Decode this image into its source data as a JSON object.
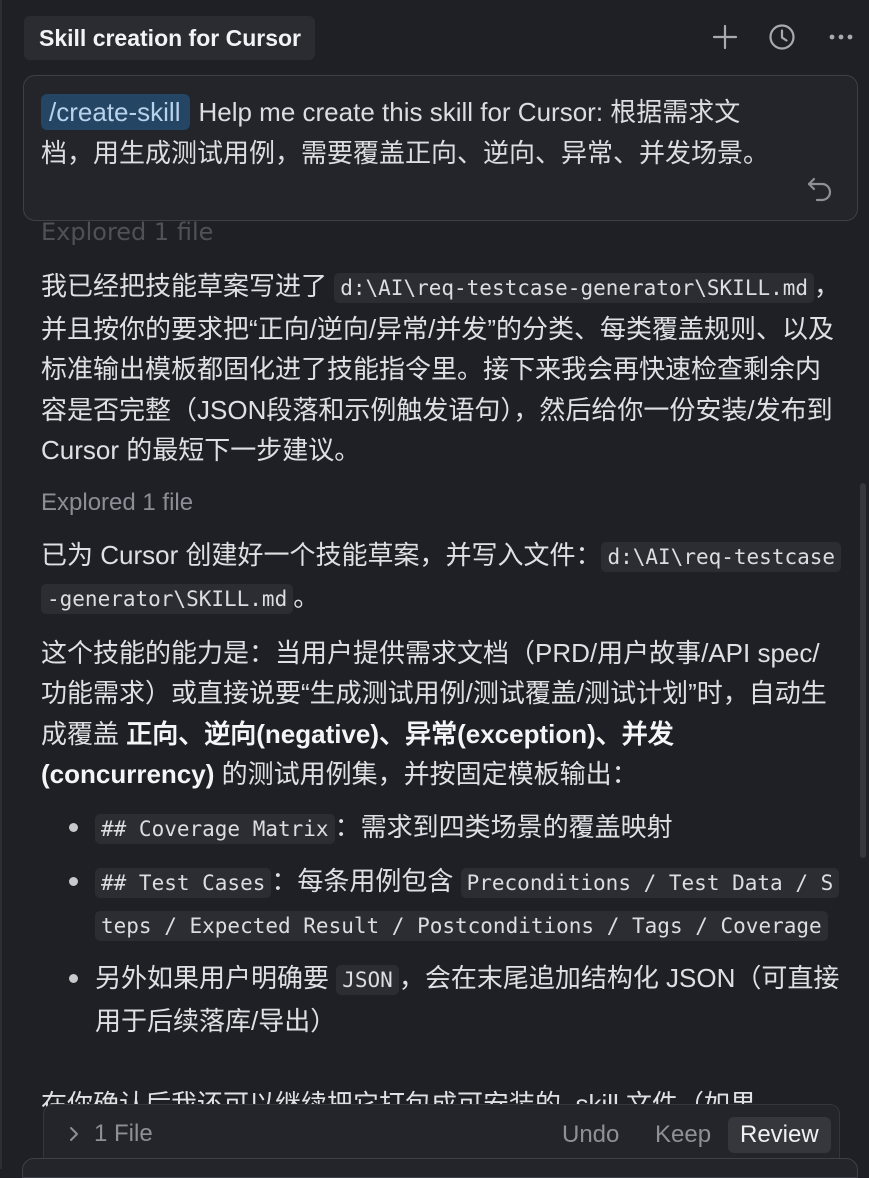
{
  "header": {
    "title": "Skill creation for Cursor",
    "icons": [
      "plus-icon",
      "history-icon",
      "more-icon"
    ]
  },
  "prompt": {
    "command": "/create-skill",
    "text": "Help me create this skill for Cursor: 根据需求文档，用生成测试用例，需要覆盖正向、逆向、异常、并发场景。"
  },
  "messages": {
    "explored_faded": "Explored 1 file",
    "p1_a": "我已经把技能草案写进了 ",
    "p1_code": "d:\\AI\\req-testcase-generator\\SKILL.md",
    "p1_b": "，并且按你的要求把“正向/逆向/异常/并发”的分类、每类覆盖规则、以及标准输出模板都固化进了技能指令里。接下来我会再快速检查剩余内容是否完整（JSON段落和示例触发语句），然后给你一份安装/发布到 Cursor 的最短下一步建议。",
    "explored": "Explored 1 file",
    "p2_a": "已为 Cursor 创建好一个技能草案，并写入文件：",
    "p2_code": "d:\\AI\\req-testcase-generator\\SKILL.md",
    "p2_b": "。",
    "p3_a": "这个技能的能力是：当用户提供需求文档（PRD/用户故事/API spec/功能需求）或直接说要“生成测试用例/测试覆盖/测试计划”时，自动生成覆盖 ",
    "p3_b1": "正向、逆向",
    "p3_b2": "(negative)",
    "p3_b3": "、异常",
    "p3_b4": "(exception)",
    "p3_b5": "、并发",
    "p3_b6": "(concurrency)",
    "p3_c": " 的测试用例集，并按固定模板输出：",
    "bullets": {
      "b1_code": "## Coverage Matrix",
      "b1_text": "：需求到四类场景的覆盖映射",
      "b2_code": "## Test Cases",
      "b2_text": "：每条用例包含 ",
      "b2_code2": "Preconditions / Test Data / Steps / Expected Result / Postconditions / Tags / Coverage",
      "b3_a": "另外如果用户明确要 ",
      "b3_code": "JSON",
      "b3_b": "，会在末尾追加结构化 JSON（可直接用于后续落库/导出）"
    },
    "peek": "在你确认后我还可以继续把它打包成可安装的 .skill 文件（如果"
  },
  "review_bar": {
    "files": "1 File",
    "undo": "Undo",
    "keep": "Keep",
    "review": "Review"
  },
  "colors": {
    "background": "#1e2025",
    "command_chip": "#244563",
    "code_bg": "#2b2d32"
  }
}
